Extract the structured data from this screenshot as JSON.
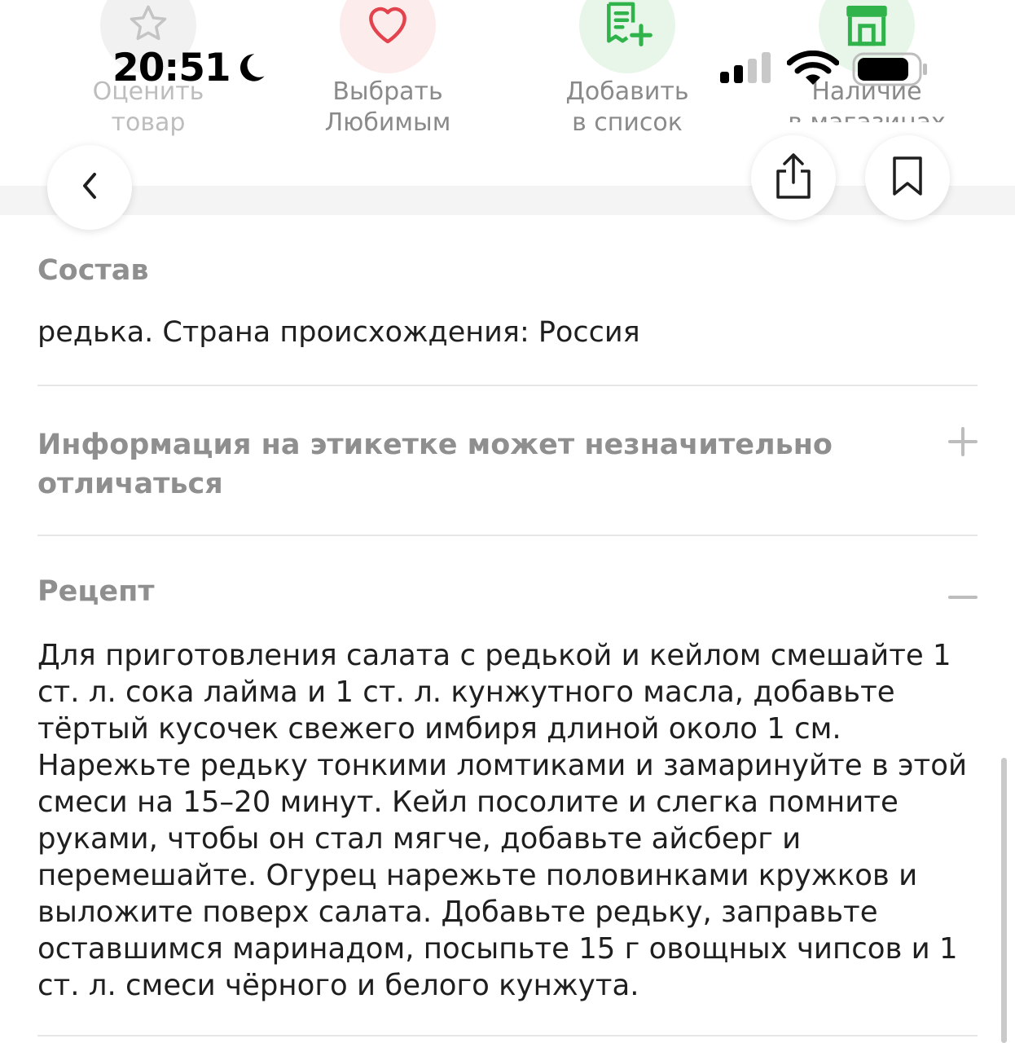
{
  "actions": [
    {
      "name": "rate-product",
      "icon": "star-icon",
      "label_line1": "Оценить",
      "label_line2": "товар"
    },
    {
      "name": "choose-favorite",
      "icon": "heart-icon",
      "label_line1": "Выбрать",
      "label_line2": "Любимым"
    },
    {
      "name": "add-to-list",
      "icon": "add-to-list-icon",
      "label_line1": "Добавить",
      "label_line2": "в список"
    },
    {
      "name": "store-availability",
      "icon": "store-icon",
      "label_line1": "Наличие",
      "label_line2": "в магазинах"
    }
  ],
  "status_bar": {
    "time": "20:51",
    "icons": [
      "moon-icon",
      "signal-icon",
      "wifi-icon",
      "battery-icon"
    ]
  },
  "nav": {
    "back_icon": "chevron-left-icon",
    "share_icon": "share-icon",
    "bookmark_icon": "bookmark-icon"
  },
  "composition": {
    "title": "Состав",
    "text": "редька. Страна происхождения: Россия"
  },
  "label_info": {
    "text": "Информация на этикетке может незначительно отличаться",
    "icon": "plus-icon"
  },
  "recipe": {
    "title": "Рецепт",
    "icon": "minus-icon",
    "text": "Для приготовления салата с редькой и кейлом смешайте 1 ст. л. сока лайма и 1 ст. л. кунжутного масла, добавьте тёртый кусочек свежего имбиря длиной около 1 см. Нарежьте редьку тонкими ломтиками и замаринуйте в этой смеси на 15–20 минут. Кейл посолите и слегка помните руками, чтобы он стал мягче, добавьте айсберг и перемешайте. Огурец нарежьте половинками кружков и выложите поверх салата. Добавьте редьку, заправьте оставшимся маринадом, посыпьте 15 г овощных чипсов и 1 ст. л. смеси чёрного и белого кунжута."
  },
  "colors": {
    "accent_green": "#2fb34a",
    "heart_red": "#e2434d",
    "muted_gray": "#8f8f8f"
  }
}
